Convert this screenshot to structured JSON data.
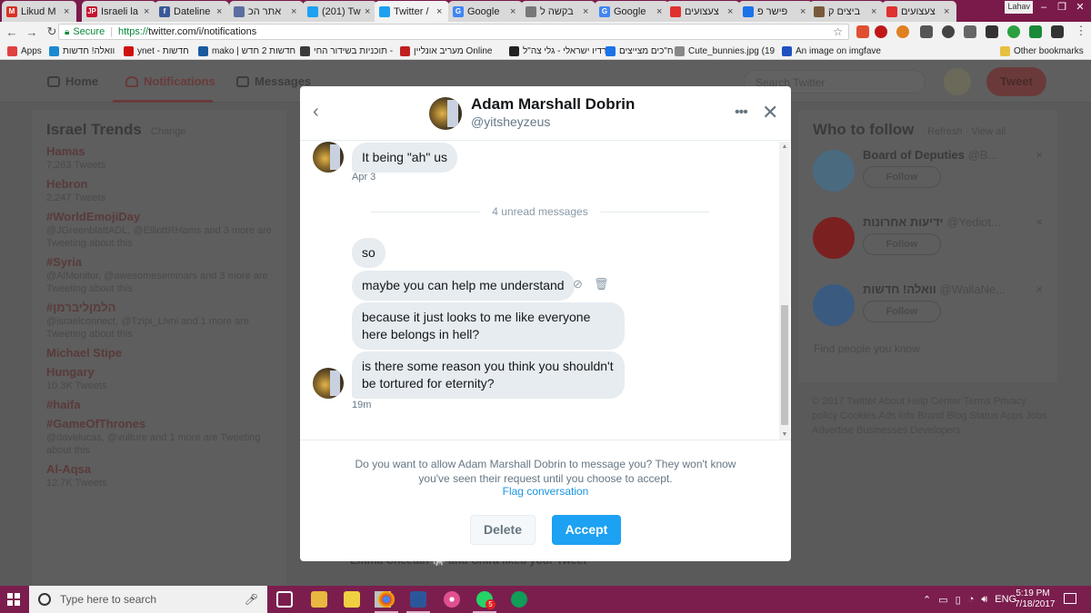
{
  "browser": {
    "tabs": [
      {
        "title": "Likud M",
        "icon": "gmail-icon",
        "color": "#d93025",
        "glyph": "M"
      },
      {
        "title": "Israeli la",
        "icon": "jpost-icon",
        "color": "#c8102e",
        "glyph": "JP"
      },
      {
        "title": "Dateline",
        "icon": "facebook-icon",
        "color": "#3b5998",
        "glyph": "f"
      },
      {
        "title": "אתר הכ",
        "icon": "page-icon",
        "color": "#5a6ea0",
        "glyph": ""
      },
      {
        "title": "(201) Tw",
        "icon": "twitter-icon",
        "color": "#1da1f2",
        "glyph": ""
      },
      {
        "title": "Twitter /",
        "icon": "twitter-icon",
        "color": "#1da1f2",
        "glyph": ""
      },
      {
        "title": "Google",
        "icon": "google-translate-icon",
        "color": "#4285f4",
        "glyph": "G"
      },
      {
        "title": "בקשה ל",
        "icon": "doc-icon",
        "color": "#777777",
        "glyph": ""
      },
      {
        "title": "Google",
        "icon": "google-translate-icon",
        "color": "#4285f4",
        "glyph": "G"
      },
      {
        "title": "צעצועים",
        "icon": "store-icon",
        "color": "#e03030",
        "glyph": ""
      },
      {
        "title": "פישר פ",
        "icon": "page-icon",
        "color": "#1a73e8",
        "glyph": ""
      },
      {
        "title": "ביצים ק",
        "icon": "image-icon",
        "color": "#7a5a3a",
        "glyph": ""
      },
      {
        "title": "צעצועים",
        "icon": "store-icon",
        "color": "#e03030",
        "glyph": ""
      }
    ],
    "user_label": "Lahav",
    "secure_label": "Secure",
    "url_scheme": "https://",
    "url_rest": "twitter.com/i/notifications",
    "bookmarks": [
      {
        "label": "Apps",
        "color": "#e04040"
      },
      {
        "label": "וואלה! חדשות",
        "color": "#1a8ad0"
      },
      {
        "label": "ynet - חדשות",
        "color": "#d01010"
      },
      {
        "label": "mako | חדשות 2 חדש",
        "color": "#1a5aa0"
      },
      {
        "label": "תוכניות בשידור החי -",
        "color": "#3a3a3a"
      },
      {
        "label": "מעריב אונליין Online",
        "color": "#c02020"
      },
      {
        "label": "רדיו ישראלי - גלי צה\"ל",
        "color": "#222222"
      },
      {
        "label": "ח\"כים מצייצים",
        "color": "#1a73e8"
      },
      {
        "label": "Cute_bunnies.jpg (19",
        "color": "#888888"
      },
      {
        "label": "An image on imgfave",
        "color": "#2050c0"
      }
    ],
    "other_bookmarks": "Other bookmarks"
  },
  "twitter_bg": {
    "nav": {
      "home": "Home",
      "notifications": "Notifications",
      "messages": "Messages"
    },
    "search_placeholder": "Search Twitter",
    "tweet_button": "Tweet",
    "trends": {
      "title": "Israel Trends",
      "change": "Change",
      "items": [
        {
          "name": "Hamas",
          "detail": "7,263 Tweets"
        },
        {
          "name": "Hebron",
          "detail": "2,247 Tweets"
        },
        {
          "name": "#WorldEmojiDay",
          "detail": "@JGreenblattADL, @ElliottRHams and 3 more are Tweeting about this"
        },
        {
          "name": "#Syria",
          "detail": "@AlMonitor, @awesomeseminars and 3 more are Tweeting about this"
        },
        {
          "name": "#הלמןליברמן",
          "detail": "@israelconnect, @Tzipi_Livni and 1 more are Tweeting about this"
        },
        {
          "name": "Michael Stipe",
          "detail": ""
        },
        {
          "name": "Hungary",
          "detail": "10.3K Tweets"
        },
        {
          "name": "#haifa",
          "detail": ""
        },
        {
          "name": "#GameOfThrones",
          "detail": "@davelucas, @vulture and 1 more are Tweeting about this"
        },
        {
          "name": "Al-Aqsa",
          "detail": "12.7K Tweets"
        }
      ]
    },
    "who_to_follow": {
      "title": "Who to follow",
      "refresh": "· Refresh · View all",
      "items": [
        {
          "name": "Board of Deputies",
          "handle": "@B...",
          "follow": "Follow",
          "color": "#4a6a80"
        },
        {
          "name": "ידיעות אחרונות",
          "handle": "@Yediot...",
          "follow": "Follow",
          "color": "#7a2020"
        },
        {
          "name": "וואלה! חדשות",
          "handle": "@WallaNe...",
          "follow": "Follow",
          "color": "#3a5a80"
        }
      ],
      "find_people": "Find people you know"
    },
    "footer": "© 2017 Twitter  About  Help Center  Terms  Privacy policy  Cookies  Ads info  Brand  Blog  Status  Apps  Jobs  Advertise  Businesses  Developers",
    "liked_line": "Emma Cheetah 🐘 and Chira liked your Tweet"
  },
  "modal": {
    "name": "Adam Marshall Dobrin",
    "handle": "@yitsheyzeus",
    "messages": [
      {
        "text": "It being \"ah\" us",
        "time": "Apr 3"
      },
      {
        "text": "so"
      },
      {
        "text": "maybe you can help me understand"
      },
      {
        "text": "because it just looks to me like everyone here belongs in hell?"
      },
      {
        "text": "is there some reason you think you shouldn't be tortured for eternity?",
        "time": "19m"
      }
    ],
    "unread_label": "4 unread messages",
    "request_text": "Do you want to allow Adam Marshall Dobrin to message you? They won't know you've seen their request until you choose to accept.",
    "flag_link": "Flag conversation",
    "delete_label": "Delete",
    "accept_label": "Accept",
    "accent_color": "#1da1f2"
  },
  "taskbar": {
    "search_placeholder": "Type here to search",
    "language": "ENG",
    "time": "5:19 PM",
    "date": "7/18/2017",
    "whatsapp_badge": "5"
  }
}
